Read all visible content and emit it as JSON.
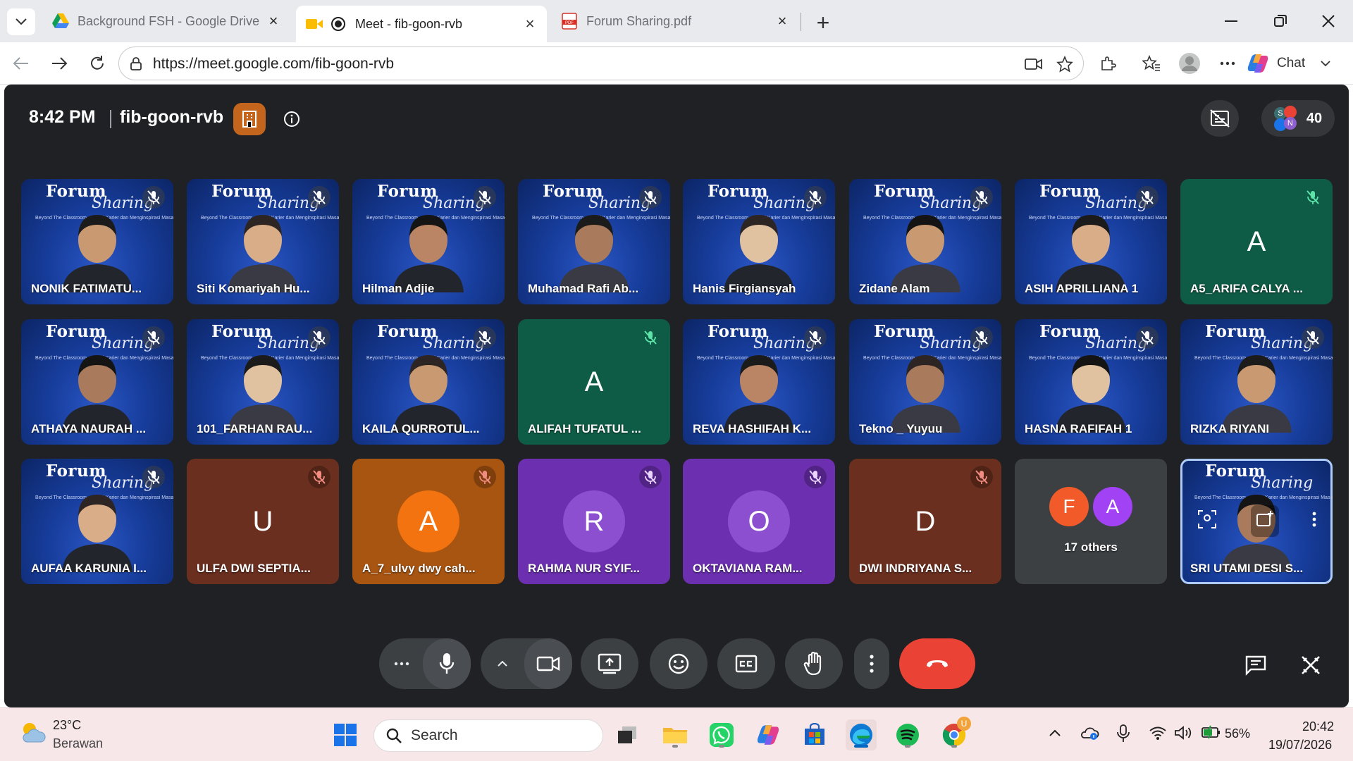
{
  "browser": {
    "tabs": [
      {
        "title": "Background FSH - Google Drive",
        "active": false
      },
      {
        "title": "Meet - fib-goon-rvb",
        "active": true
      },
      {
        "title": "Forum Sharing.pdf",
        "active": false
      }
    ],
    "url": "https://meet.google.com/fib-goon-rvb",
    "chat_label": "Chat"
  },
  "meet": {
    "time": "8:42 PM",
    "meeting_code": "fib-goon-rvb",
    "people_count": "40",
    "people_avatars": [
      "S",
      "N"
    ],
    "banner_forum": "Forum",
    "banner_sharing": "Sharing",
    "banner_tagline": "Beyond The Classroom · Meniti Karier dan Menginspirasi Masa Depan",
    "tiles": [
      {
        "name": "NONIK FATIMATU...",
        "kind": "video"
      },
      {
        "name": "Siti Komariyah Hu...",
        "kind": "video"
      },
      {
        "name": "Hilman Adjie",
        "kind": "video"
      },
      {
        "name": "Muhamad Rafi Ab...",
        "kind": "video"
      },
      {
        "name": "Hanis Firgiansyah",
        "kind": "video"
      },
      {
        "name": "Zidane Alam",
        "kind": "video"
      },
      {
        "name": "ASIH APRILLIANA 1",
        "kind": "video"
      },
      {
        "name": "A5_ARIFA CALYA ...",
        "kind": "avatar",
        "initial": "A",
        "bg": "#0f5c46",
        "circle": "#0f5c46"
      },
      {
        "name": "ATHAYA NAURAH ...",
        "kind": "video"
      },
      {
        "name": "101_FARHAN RAU...",
        "kind": "video"
      },
      {
        "name": "KAILA QURROTUL...",
        "kind": "video"
      },
      {
        "name": "ALIFAH TUFATUL ...",
        "kind": "avatar",
        "initial": "A",
        "bg": "#0f5c46",
        "circle": "#0f5c46"
      },
      {
        "name": "REVA HASHIFAH K...",
        "kind": "video"
      },
      {
        "name": "Tekno _ Yuyuu",
        "kind": "video"
      },
      {
        "name": "HASNA RAFIFAH 1",
        "kind": "video"
      },
      {
        "name": "RIZKA RIYANI",
        "kind": "video"
      },
      {
        "name": "AUFAA KARUNIA I...",
        "kind": "video"
      },
      {
        "name": "ULFA DWI SEPTIA...",
        "kind": "avatar",
        "initial": "U",
        "bg": "#6b2f1f",
        "circle": "#6b2f1f"
      },
      {
        "name": "A_7_ulvy dwy cah...",
        "kind": "avatar",
        "initial": "A",
        "bg": "#a85512",
        "circle": "#f2730f"
      },
      {
        "name": "RAHMA NUR SYIF...",
        "kind": "avatar",
        "initial": "R",
        "bg": "#6b2fb0",
        "circle": "#8c4fd0"
      },
      {
        "name": "OKTAVIANA RAM...",
        "kind": "avatar",
        "initial": "O",
        "bg": "#6b2fb0",
        "circle": "#8c4fd0"
      },
      {
        "name": "DWI INDRIYANA S...",
        "kind": "avatar",
        "initial": "D",
        "bg": "#6b2f1f",
        "circle": "#6b2f1f"
      },
      {
        "name": "17 others",
        "kind": "others",
        "initials": [
          "F",
          "A"
        ]
      },
      {
        "name": "SRI UTAMI DESI S...",
        "kind": "self"
      }
    ]
  },
  "taskbar": {
    "temperature": "23°C",
    "weather": "Berawan",
    "search_placeholder": "Search",
    "battery": "56%",
    "clock_time": "20:42",
    "clock_date": "19/07/2026",
    "chrome_badge": "U"
  }
}
